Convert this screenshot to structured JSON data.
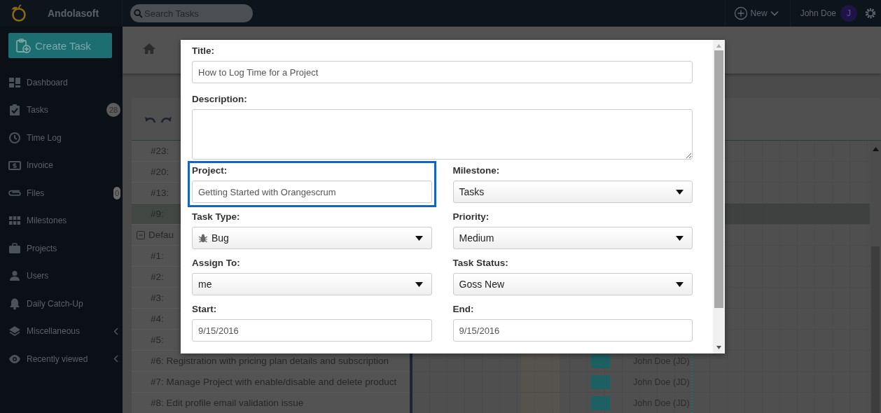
{
  "topbar": {
    "brand": "Andolasoft",
    "search": {
      "placeholder": "Search Tasks"
    },
    "new_button": "New",
    "user_name": "John Doe",
    "avatar_initial": "J"
  },
  "sidebar": {
    "create_button": "Create Task",
    "items": [
      {
        "label": "Dashboard",
        "has_submenu": false
      },
      {
        "label": "Tasks",
        "badge": "28",
        "has_submenu": false
      },
      {
        "label": "Time Log",
        "has_submenu": false
      },
      {
        "label": "Invoice",
        "has_submenu": false
      },
      {
        "label": "Files",
        "badge": "0",
        "has_submenu": false
      },
      {
        "label": "Milestones",
        "has_submenu": false
      },
      {
        "label": "Projects",
        "has_submenu": false
      },
      {
        "label": "Users",
        "has_submenu": false
      },
      {
        "label": "Daily Catch-Up",
        "has_submenu": false
      },
      {
        "label": "Miscellaneous",
        "has_submenu": true
      },
      {
        "label": "Recently viewed",
        "has_submenu": true
      }
    ]
  },
  "task_list": {
    "rows": [
      {
        "kind": "task",
        "text": "#23:",
        "highlighted": false
      },
      {
        "kind": "task",
        "text": "#20:",
        "highlighted": false
      },
      {
        "kind": "task",
        "text": "#13:",
        "highlighted": false
      },
      {
        "kind": "task",
        "text": "#9:",
        "highlighted": true
      },
      {
        "kind": "group",
        "text": "Defau",
        "highlighted": false
      },
      {
        "kind": "task",
        "text": "#1:",
        "highlighted": false
      },
      {
        "kind": "task",
        "text": "#2:",
        "highlighted": false
      },
      {
        "kind": "task",
        "text": "#3:",
        "highlighted": false
      },
      {
        "kind": "task",
        "text": "#4:",
        "highlighted": false
      },
      {
        "kind": "task",
        "text": "#5:",
        "highlighted": false
      },
      {
        "kind": "task",
        "text": "#6: Registration with pricing plan details and subscription",
        "highlighted": false,
        "assignee": "John Doe (JD)"
      },
      {
        "kind": "task",
        "text": "#7: Manage Project with enable/disable and delete product",
        "highlighted": false,
        "assignee": "John Doe (JD)"
      },
      {
        "kind": "task",
        "text": "#8: Edit profile email validation issue",
        "highlighted": false,
        "assignee": "John Doe (JD)"
      }
    ]
  },
  "modal": {
    "title_field": {
      "label": "Title:",
      "value": "How to Log Time for a Project"
    },
    "description_field": {
      "label": "Description:"
    },
    "fields": [
      {
        "label": "Project:",
        "kind": "text",
        "value": "Getting Started with Orangescrum",
        "highlighted": true
      },
      {
        "label": "Milestone:",
        "kind": "select",
        "value": "Tasks",
        "highlighted": false
      },
      {
        "label": "Task Type:",
        "kind": "icon-select",
        "value": "Bug",
        "highlighted": false
      },
      {
        "label": "Priority:",
        "kind": "select",
        "value": "Medium",
        "highlighted": false
      },
      {
        "label": "Assign To:",
        "kind": "select",
        "value": "me",
        "highlighted": false
      },
      {
        "label": "Task Status:",
        "kind": "select",
        "value": "Goss New",
        "highlighted": false
      },
      {
        "label": "Start:",
        "kind": "text",
        "value": "9/15/2016",
        "highlighted": false
      },
      {
        "label": "End:",
        "kind": "text",
        "value": "9/15/2016",
        "highlighted": false
      }
    ]
  }
}
